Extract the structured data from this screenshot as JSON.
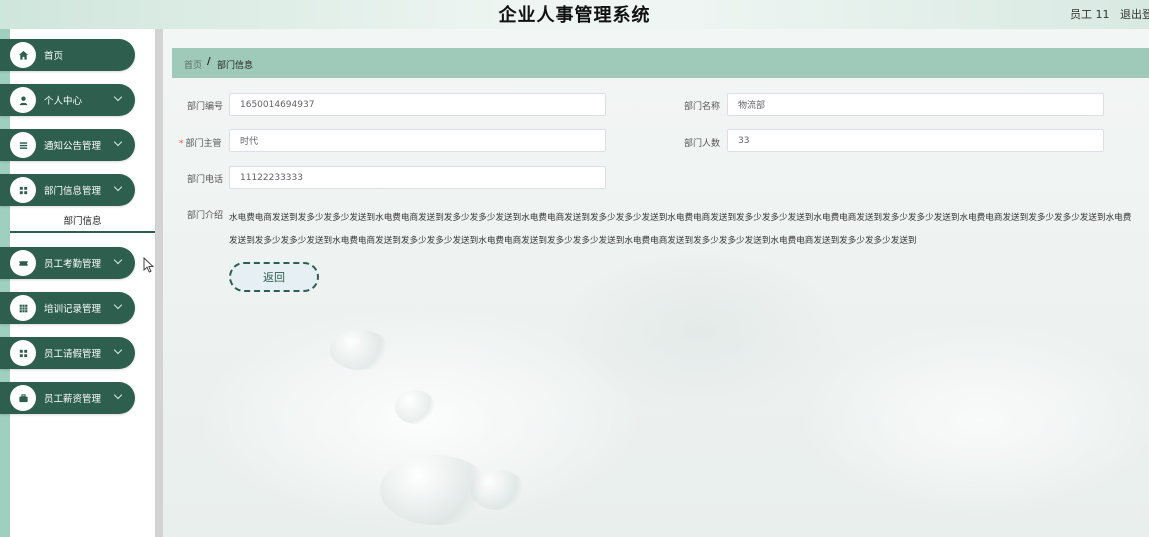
{
  "header": {
    "title": "企业人事管理系统",
    "user": "员工 11",
    "logout": "退出登"
  },
  "sidebar": {
    "items": [
      {
        "label": "首页",
        "icon": "home-icon",
        "chevron": false
      },
      {
        "label": "个人中心",
        "icon": "person-icon",
        "chevron": true
      },
      {
        "label": "通知公告管理",
        "icon": "list-icon",
        "chevron": true
      },
      {
        "label": "部门信息管理",
        "icon": "grid-icon",
        "chevron": true
      }
    ],
    "submenu": {
      "label": "部门信息"
    },
    "items2": [
      {
        "label": "员工考勤管理",
        "icon": "ticket-icon",
        "chevron": true
      },
      {
        "label": "培训记录管理",
        "icon": "grid-icon",
        "chevron": true
      },
      {
        "label": "员工请假管理",
        "icon": "grid-icon",
        "chevron": true
      },
      {
        "label": "员工薪资管理",
        "icon": "briefcase-icon",
        "chevron": true
      }
    ]
  },
  "breadcrumb": {
    "home": "首页",
    "separator": "/",
    "current": "部门信息"
  },
  "form": {
    "dept_no": {
      "label": "部门编号",
      "value": "1650014694937"
    },
    "dept_name": {
      "label": "部门名称",
      "value": "物流部"
    },
    "manager": {
      "label": "部门主管",
      "value": "时代",
      "required_mark": "*"
    },
    "headcount": {
      "label": "部门人数",
      "value": "33"
    },
    "phone": {
      "label": "部门电话",
      "value": "11122233333"
    },
    "intro": {
      "label": "部门介绍",
      "line1": "水电费电商发送到发多少发多少发送到水电费电商发送到发多少发多少发送到水电费电商发送到发多少发多少发送到水电费电商发送到发多少发多少发送到水电费电商发送到发多少发多少发送到水电费电商发送到发多少发多少发送到水电费",
      "line2": "发送到发多少发多少发送到水电费电商发送到发多少发多少发送到水电费电商发送到发多少发多少发送到水电费电商发送到发多少发多少发送到水电费电商发送到发多少发多少发送到"
    }
  },
  "actions": {
    "back_label": "返回"
  },
  "colors": {
    "accent": "#2d5e4e",
    "breadcrumb_bar": "#9fcab9",
    "sidebar_edge": "#9fcfbf"
  }
}
